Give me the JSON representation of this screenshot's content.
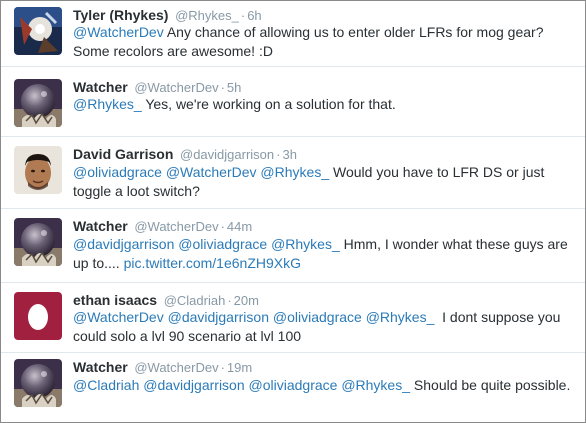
{
  "tweets": [
    {
      "fullname": "Tyler (Rhykes)",
      "handle": "@Rhykes_",
      "time": "6h",
      "avatar": "tyler-avatar",
      "line1": [
        {
          "t": "mention",
          "v": "@WatcherDev"
        },
        {
          "t": "text",
          "v": " Any chance of allowing us to enter older LFRs for mog gear?"
        }
      ],
      "line2": [
        {
          "t": "text",
          "v": "Some recolors are awesome! :D"
        }
      ]
    },
    {
      "fullname": "Watcher",
      "handle": "@WatcherDev",
      "time": "5h",
      "avatar": "watcher-avatar",
      "line1": [
        {
          "t": "mention",
          "v": "@Rhykes_"
        },
        {
          "t": "text",
          "v": " Yes, we're working on a solution for that."
        }
      ],
      "line2": []
    },
    {
      "fullname": "David Garrison",
      "handle": "@davidjgarrison",
      "time": "3h",
      "avatar": "david-avatar",
      "line1": [
        {
          "t": "mention",
          "v": "@oliviadgrace"
        },
        {
          "t": "text",
          "v": " "
        },
        {
          "t": "mention",
          "v": "@WatcherDev"
        },
        {
          "t": "text",
          "v": " "
        },
        {
          "t": "mention",
          "v": "@Rhykes_"
        },
        {
          "t": "text",
          "v": " Would you have to LFR DS or just"
        }
      ],
      "line2": [
        {
          "t": "text",
          "v": "toggle a loot switch?"
        }
      ]
    },
    {
      "fullname": "Watcher",
      "handle": "@WatcherDev",
      "time": "44m",
      "avatar": "watcher-avatar",
      "line1": [
        {
          "t": "mention",
          "v": "@davidjgarrison"
        },
        {
          "t": "text",
          "v": " "
        },
        {
          "t": "mention",
          "v": "@oliviadgrace"
        },
        {
          "t": "text",
          "v": " "
        },
        {
          "t": "mention",
          "v": "@Rhykes_"
        },
        {
          "t": "text",
          "v": " Hmm, I wonder what these guys are"
        }
      ],
      "line2": [
        {
          "t": "text",
          "v": "up to.... "
        },
        {
          "t": "link",
          "v": "pic.twitter.com/1e6nZH9XkG"
        }
      ]
    },
    {
      "fullname": "ethan isaacs",
      "handle": "@Cladriah",
      "time": "20m",
      "avatar": "egg-avatar",
      "line1": [
        {
          "t": "mention",
          "v": "@WatcherDev"
        },
        {
          "t": "text",
          "v": " "
        },
        {
          "t": "mention",
          "v": "@davidjgarrison"
        },
        {
          "t": "text",
          "v": " "
        },
        {
          "t": "mention",
          "v": "@oliviadgrace"
        },
        {
          "t": "text",
          "v": " "
        },
        {
          "t": "mention",
          "v": "@Rhykes_"
        },
        {
          "t": "text",
          "v": "  I dont suppose you"
        }
      ],
      "line2": [
        {
          "t": "text",
          "v": "could solo a lvl 90 scenario at lvl 100"
        }
      ]
    },
    {
      "fullname": "Watcher",
      "handle": "@WatcherDev",
      "time": "19m",
      "avatar": "watcher-avatar",
      "line1": [
        {
          "t": "mention",
          "v": "@Cladriah"
        },
        {
          "t": "text",
          "v": " "
        },
        {
          "t": "mention",
          "v": "@davidjgarrison"
        },
        {
          "t": "text",
          "v": " "
        },
        {
          "t": "mention",
          "v": "@oliviadgrace"
        },
        {
          "t": "text",
          "v": " "
        },
        {
          "t": "mention",
          "v": "@Rhykes_"
        },
        {
          "t": "text",
          "v": " Should be quite possible."
        }
      ],
      "line2": []
    }
  ],
  "separator": "·",
  "colors": {
    "name": "#292f33",
    "meta": "#8899a6",
    "mention": "#2b7bb9",
    "divider": "#e1e8ed",
    "egg_bg": "#a2203f"
  }
}
